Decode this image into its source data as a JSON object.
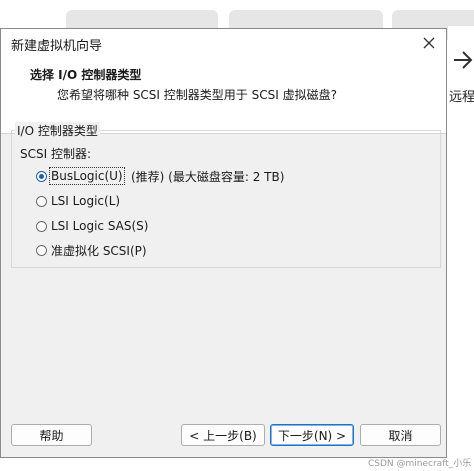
{
  "background": {
    "right_label": "远程"
  },
  "dialog": {
    "title": "新建虚拟机向导",
    "header_title": "选择 I/O 控制器类型",
    "header_subtitle": "您希望将哪种 SCSI 控制器类型用于 SCSI 虚拟磁盘?",
    "group_label": "I/O 控制器类型",
    "scsi_label": "SCSI 控制器:",
    "options": [
      {
        "label": "BusLogic(U)",
        "selected": true
      },
      {
        "label": "LSI Logic(L)",
        "selected": false
      },
      {
        "label": "LSI Logic SAS(S)",
        "selected": false
      },
      {
        "label": "准虚拟化 SCSI(P)",
        "selected": false
      }
    ],
    "recommend_note": "(推荐) (最大磁盘容量: 2 TB)",
    "buttons": {
      "help": "帮助",
      "back": "< 上一步(B)",
      "next": "下一步(N) >",
      "cancel": "取消"
    }
  },
  "watermark": "CSDN @minecraft_小乐"
}
